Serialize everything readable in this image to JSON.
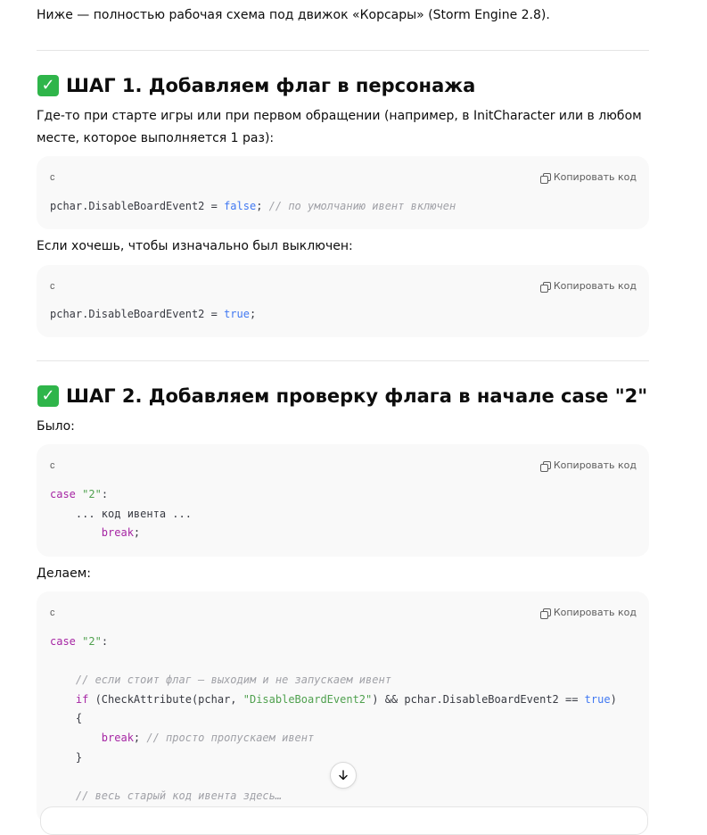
{
  "intro": "Ниже — полностью рабочая схема под движок «Корсары» (Storm Engine 2.8).",
  "step1": {
    "title": "ШАГ 1. Добавляем флаг в персонажа",
    "desc": "Где-то при старте игры или при первом обращении (например, в InitCharacter или в любом месте, которое выполняется 1 раз):",
    "code1": {
      "lang": "c",
      "copy": "Копировать код",
      "l1a": "pchar.DisableBoardEvent2 = ",
      "l1b": "false",
      "l1c": "; ",
      "l1d": "// по умолчанию ивент включен"
    },
    "desc2": "Если хочешь, чтобы изначально был выключен:",
    "code2": {
      "lang": "c",
      "copy": "Копировать код",
      "l1a": "pchar.DisableBoardEvent2 = ",
      "l1b": "true",
      "l1c": ";"
    }
  },
  "step2": {
    "title": "ШАГ 2. Добавляем проверку флага в начале case \"2\"",
    "was": "Было:",
    "code3": {
      "lang": "c",
      "copy": "Копировать код",
      "case": "case",
      "str": "\"2\"",
      "colon": ":",
      "l2": "    ... код ивента ...",
      "brk": "break",
      "semi": ";"
    },
    "do": "Делаем:",
    "code4": {
      "lang": "c",
      "copy": "Копировать код",
      "case": "case",
      "str": "\"2\"",
      "colon": ":",
      "c1": "// если стоит флаг – выходим и не запускаем ивент",
      "if": "if",
      "p1": " (CheckAttribute(pchar, ",
      "s1": "\"DisableBoardEvent2\"",
      "p2": ") && pchar.DisableBoardEvent2 == ",
      "t1": "true",
      "p3": ")",
      "ob": "{",
      "brk": "break",
      "semi": "; ",
      "c2": "// просто пропускаем ивент",
      "cb": "}",
      "c3": "// весь старый код ивента здесь…"
    }
  },
  "icons": {
    "check": "check-mark-icon",
    "copy": "copy-icon",
    "scroll": "arrow-down-icon"
  },
  "colors": {
    "check": "#2fb54a",
    "keyword": "#a626a4",
    "bool": "#4078f2",
    "string": "#50a14f",
    "comment": "#a0a1a7"
  }
}
